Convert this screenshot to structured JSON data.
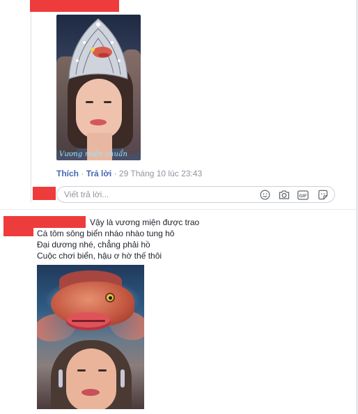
{
  "reply": {
    "image_caption": "Vương miện chuẩn",
    "actions": {
      "like": "Thích",
      "reply": "Trả lời",
      "separator": "·"
    },
    "timestamp": "29 Tháng 10 lúc 23:43"
  },
  "reply_box": {
    "placeholder": "Viết trả lời...",
    "icons": [
      "emoji-icon",
      "camera-icon",
      "gif-icon",
      "sticker-icon"
    ],
    "gif_label": "GIF"
  },
  "comment": {
    "lines": [
      "Vậy là vương miện được trao",
      "Cá tôm sông biển nháo nhào tung hô",
      "Đại dương nhé, chẳng phải hồ",
      "Cuộc chơi biển, hậu ơ hờ thế thôi"
    ]
  },
  "colors": {
    "link": "#4267b2",
    "meta": "#90949c",
    "redaction": "#ee3b3b"
  }
}
